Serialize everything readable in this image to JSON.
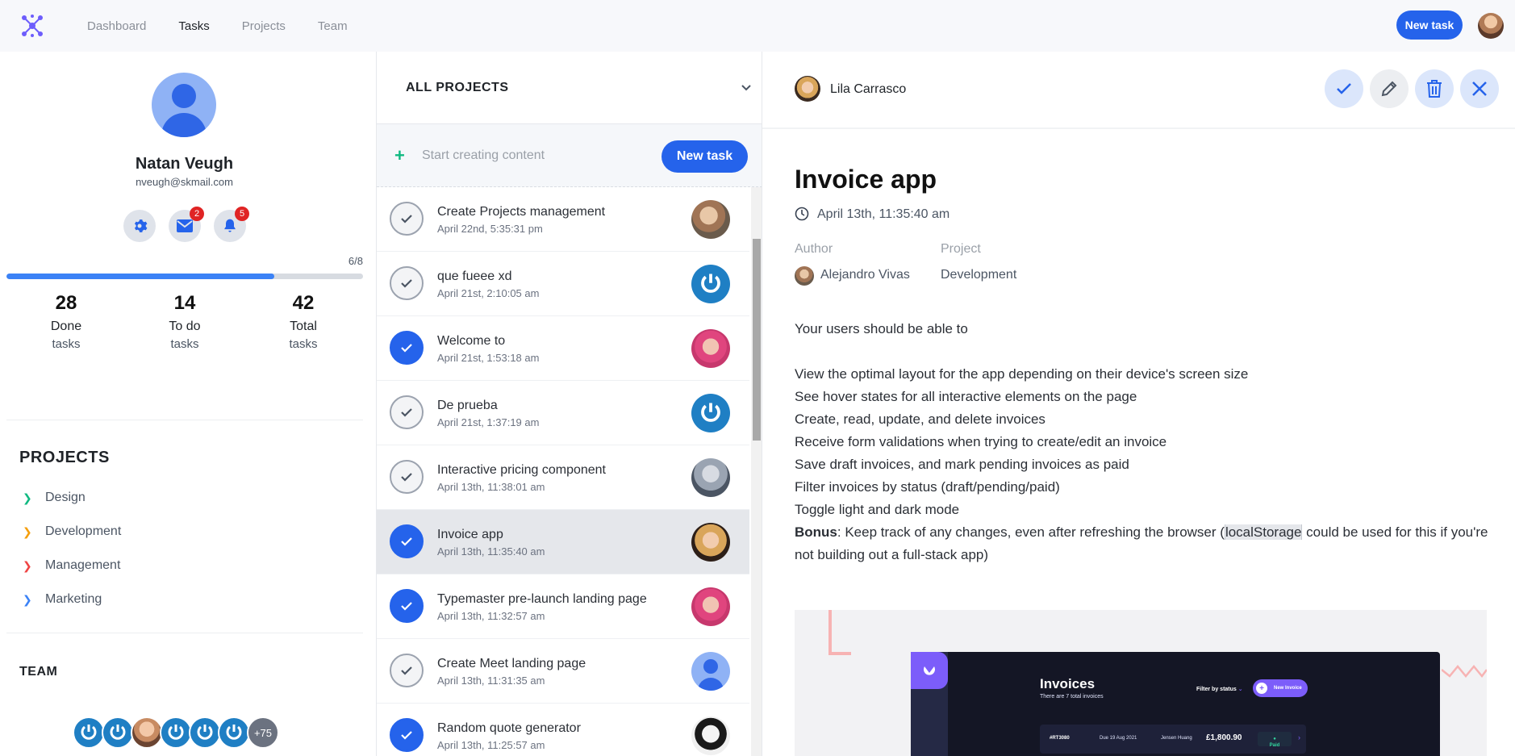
{
  "topbar": {
    "nav": [
      "Dashboard",
      "Tasks",
      "Projects",
      "Team"
    ],
    "active_nav": "Tasks",
    "new_task_label": "New task"
  },
  "profile": {
    "name": "Natan Veugh",
    "email": "nveugh@skmail.com",
    "mail_badge": "2",
    "notif_badge": "5",
    "progress_label": "6/8",
    "progress_fraction": 0.75,
    "stats": [
      {
        "num": "28",
        "l1": "Done",
        "l2": "tasks"
      },
      {
        "num": "14",
        "l1": "To do",
        "l2": "tasks"
      },
      {
        "num": "42",
        "l1": "Total",
        "l2": "tasks"
      }
    ]
  },
  "projects": {
    "title": "PROJECTS",
    "items": [
      {
        "label": "Design",
        "color": "#10b981"
      },
      {
        "label": "Development",
        "color": "#f59e0b"
      },
      {
        "label": "Management",
        "color": "#ef4444"
      },
      {
        "label": "Marketing",
        "color": "#3b82f6"
      }
    ]
  },
  "team": {
    "title": "TEAM",
    "more": "+75"
  },
  "middle": {
    "project_select": "ALL PROJECTS",
    "create_placeholder": "Start creating content",
    "new_task_label": "New task",
    "tasks": [
      {
        "title": "Create Projects management",
        "date": "April 22nd, 5:35:31 pm",
        "done": false,
        "avatar": "photo1"
      },
      {
        "title": "que fueee xd",
        "date": "April 21st, 2:10:05 am",
        "done": false,
        "avatar": "power"
      },
      {
        "title": "Welcome to",
        "date": "April 21st, 1:53:18 am",
        "done": true,
        "avatar": "pink"
      },
      {
        "title": "De prueba",
        "date": "April 21st, 1:37:19 am",
        "done": false,
        "avatar": "power"
      },
      {
        "title": "Interactive pricing component",
        "date": "April 13th, 11:38:01 am",
        "done": false,
        "avatar": "grey"
      },
      {
        "title": "Invoice app",
        "date": "April 13th, 11:35:40 am",
        "done": true,
        "avatar": "blonde",
        "selected": true
      },
      {
        "title": "Typemaster pre-launch landing page",
        "date": "April 13th, 11:32:57 am",
        "done": true,
        "avatar": "pink"
      },
      {
        "title": "Create Meet landing page",
        "date": "April 13th, 11:31:35 am",
        "done": false,
        "avatar": "default"
      },
      {
        "title": "Random quote generator",
        "date": "April 13th, 11:25:57 am",
        "done": true,
        "avatar": "sketch"
      }
    ]
  },
  "detail": {
    "owner": "Lila Carrasco",
    "title": "Invoice app",
    "date": "April 13th, 11:35:40 am",
    "author_label": "Author",
    "author": "Alejandro Vivas",
    "project_label": "Project",
    "project": "Development",
    "intro": "Your users should be able to",
    "lines": [
      "View the optimal layout for the app depending on their device's screen size",
      "See hover states for all interactive elements on the page",
      "Create, read, update, and delete invoices",
      "Receive form validations when trying to create/edit an invoice",
      "Save draft invoices, and mark pending invoices as paid",
      "Filter invoices by status (draft/pending/paid)",
      "Toggle light and dark mode"
    ],
    "bonus_label": "Bonus",
    "bonus_pre": ": Keep track of any changes, even after refreshing the browser (",
    "bonus_code": "localStorage",
    "bonus_post": " could be used for this if you're not building out a full-stack app)",
    "preview": {
      "heading": "Invoices",
      "sub": "There are 7 total invoices",
      "filter": "Filter by status",
      "new_invoice": "New Invoice",
      "row_id": "#RT3080",
      "row_due": "Due 19 Aug 2021",
      "row_name": "Jensen Huang",
      "row_amount": "£1,800.90",
      "row_status": "Paid"
    }
  }
}
